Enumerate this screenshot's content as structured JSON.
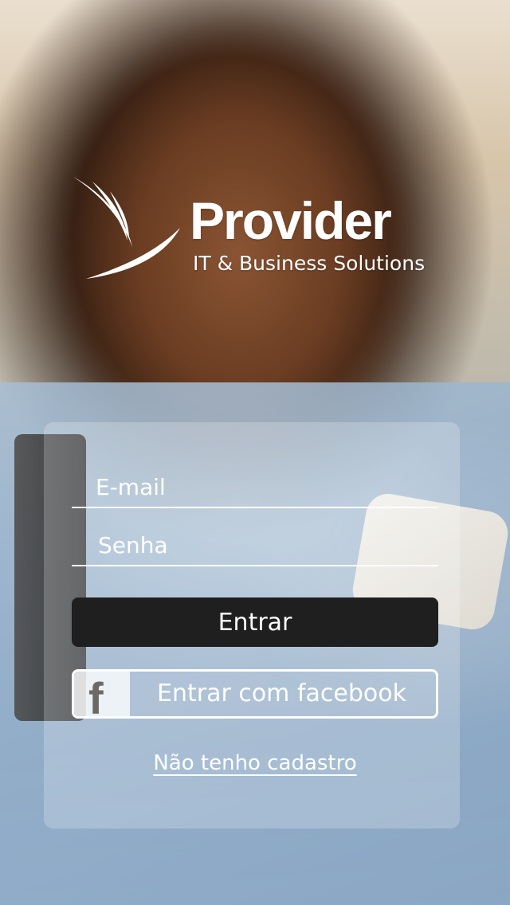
{
  "brand": {
    "name": "Provider",
    "tagline": "IT & Business Solutions",
    "logo_icon": "swoosh-logo-icon"
  },
  "login": {
    "email_placeholder": "E-mail",
    "password_placeholder": "Senha",
    "submit_label": "Entrar",
    "facebook_label": "Entrar com facebook",
    "facebook_icon": "facebook-icon",
    "register_link": "Não tenho cadastro"
  },
  "colors": {
    "login_button": "#201f1f",
    "text": "#ffffff",
    "panel_overlay": "rgba(255,255,255,0.22)"
  }
}
